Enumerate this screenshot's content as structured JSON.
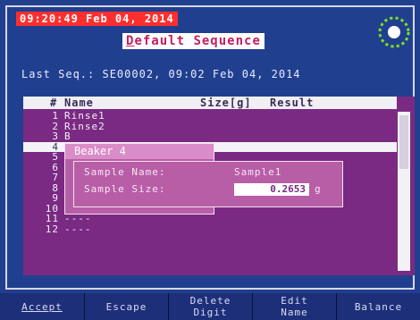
{
  "header": {
    "timestamp": "09:20:49 Feb 04, 2014",
    "title_initial": "D",
    "title_rest": "efault Sequence"
  },
  "status_icon": "sun-icon",
  "last_seq": "Last Seq.: SE00002, 09:02 Feb 04, 2014",
  "table": {
    "headers": {
      "num": "#",
      "name": "Name",
      "size": "Size[g]",
      "result": "Result"
    },
    "rows": [
      {
        "num": "1",
        "name": "Rinse1"
      },
      {
        "num": "2",
        "name": "Rinse2"
      },
      {
        "num": "3",
        "name": "B"
      },
      {
        "num": "4",
        "name": ""
      },
      {
        "num": "5",
        "name": "-"
      },
      {
        "num": "6",
        "name": "-"
      },
      {
        "num": "7",
        "name": "-"
      },
      {
        "num": "8",
        "name": "----"
      },
      {
        "num": "9",
        "name": "----"
      },
      {
        "num": "10",
        "name": "----"
      },
      {
        "num": "11",
        "name": "----"
      },
      {
        "num": "12",
        "name": "----"
      }
    ],
    "selected_row": "4"
  },
  "popup": {
    "title": "Beaker 4",
    "sample_name_label": "Sample Name:",
    "sample_name_value": "Sample1",
    "sample_size_label": "Sample Size:",
    "sample_size_value": "0.2653",
    "sample_size_unit": "g"
  },
  "softkeys": {
    "accept": "Accept",
    "escape": "Escape",
    "delete_digit": "Delete\nDigit",
    "edit_name": "Edit\nName",
    "balance": "Balance"
  },
  "colors": {
    "screen_bg": "#213f8f",
    "table_bg": "#7a2a82",
    "popup_bg": "#b85ea7",
    "timestamp_bg": "#ff2f2f",
    "status_icon": "#7ee022"
  }
}
